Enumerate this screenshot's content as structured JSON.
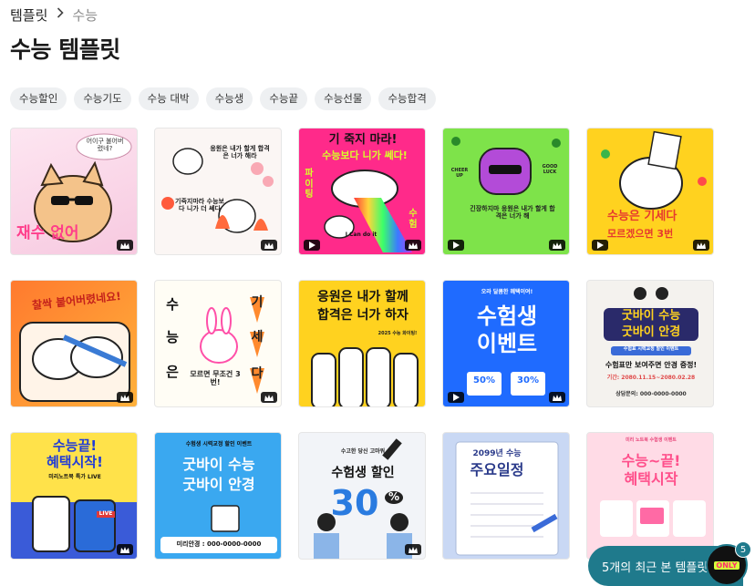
{
  "breadcrumb": {
    "parent": "템플릿",
    "current": "수능"
  },
  "page_title": "수능 템플릿",
  "chips": [
    "수능할인",
    "수능기도",
    "수능 대박",
    "수능생",
    "수능끝",
    "수능선물",
    "수능합격"
  ],
  "cards": [
    {
      "texts": [
        "어이구 불어버렸네?",
        "재수 없어"
      ],
      "video": false
    },
    {
      "texts": [
        "응원은 내가 할게 합격은 너가 해라",
        "기죽지마라 수능보다 니가 더 쎄다"
      ],
      "video": false
    },
    {
      "texts": [
        "기 죽지 마라!",
        "수능보다 니가 쎄다!",
        "파이팅",
        "I Can do it",
        "수험"
      ],
      "video": true
    },
    {
      "texts": [
        "긴장하지마 응원은 내가 할게 합격은 너가 해",
        "CHEER UP",
        "GOOD LUCK"
      ],
      "video": true
    },
    {
      "texts": [
        "수능은 기세다",
        "모르겠으면 3번"
      ],
      "video": true
    },
    {
      "texts": [
        "찰싹 붙어버렸네요!"
      ],
      "video": false
    },
    {
      "texts": [
        "수",
        "능",
        "은",
        "기",
        "세",
        "다",
        "모르면 무조건 3번!"
      ],
      "video": false
    },
    {
      "texts": [
        "응원은 내가 할께",
        "합격은 너가 하자",
        "2025 수능 화이팅!"
      ],
      "video": false
    },
    {
      "texts": [
        "오라 달콤한 혜택이여!",
        "수험생",
        "이벤트",
        "50%",
        "30%"
      ],
      "video": true
    },
    {
      "texts": [
        "굿바이 수능",
        "굿바이 안경",
        "수험표 시력교정 할인 이벤트",
        "수험표만 보여주면 안경 증정!",
        "기간: 2080.11.15~2080.02.28",
        "상담문의: 000-0000-0000"
      ],
      "video": false
    },
    {
      "texts": [
        "수능끝!",
        "혜택시작!",
        "미리노트북 특가 LIVE",
        "LIVE"
      ],
      "video": false
    },
    {
      "texts": [
        "수험생 시력교정 할인 이벤트",
        "굿바이 수능",
        "굿바이 안경",
        "미리안경 : 000-0000-0000"
      ],
      "video": false
    },
    {
      "texts": [
        "수고한 당신 고마워",
        "수험생 할인",
        "30",
        "%"
      ],
      "video": false
    },
    {
      "texts": [
        "2099년 수능",
        "주요일정"
      ],
      "video": false
    },
    {
      "texts": [
        "미리 노트북 수험생 이벤트",
        "수능~끝!",
        "혜택시작"
      ],
      "video": false
    }
  ],
  "recent": {
    "label": "5개의 최근 본 템플릿",
    "count": "5",
    "thumb_text": "ONLY"
  },
  "colors": {
    "accent": "#1f7a8c",
    "chip_bg": "#eef0f2"
  }
}
